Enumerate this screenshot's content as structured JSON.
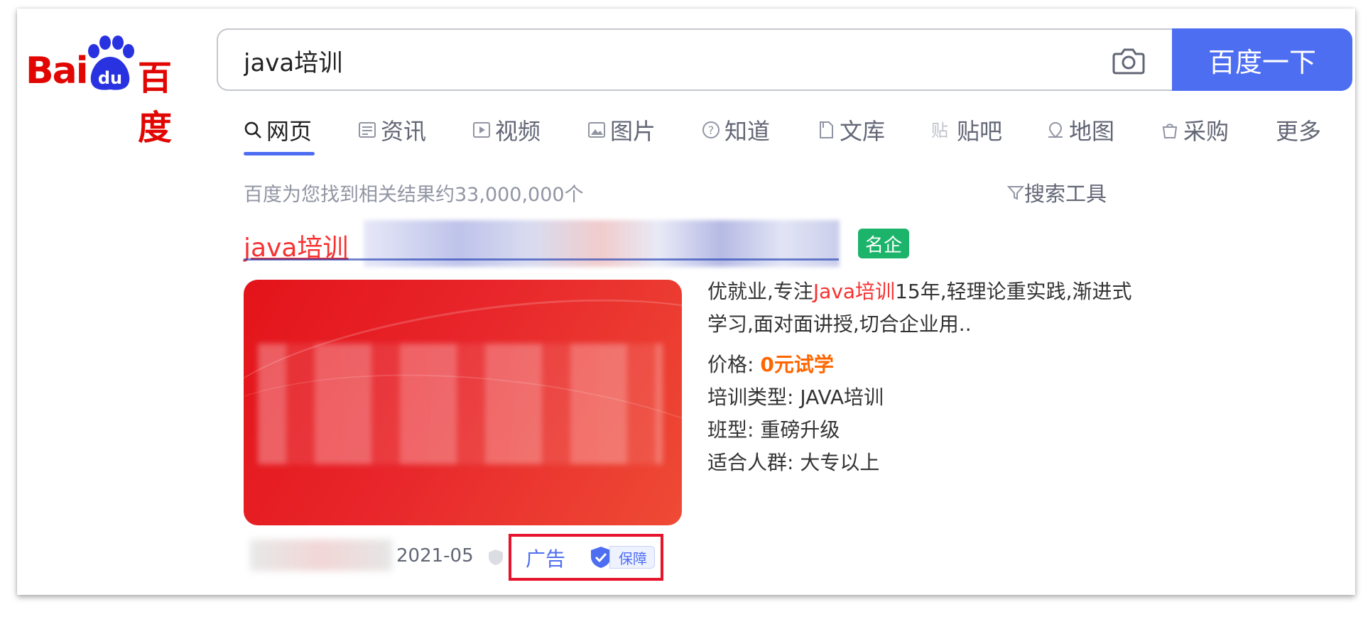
{
  "logo": {
    "bai": "Bai",
    "du": "du",
    "baidu_cn": "百度"
  },
  "search": {
    "value": "java培训",
    "button_label": "百度一下"
  },
  "tabs": [
    {
      "label": "网页",
      "icon": "search-icon",
      "active": true
    },
    {
      "label": "资讯",
      "icon": "news-icon"
    },
    {
      "label": "视频",
      "icon": "video-icon"
    },
    {
      "label": "图片",
      "icon": "image-icon"
    },
    {
      "label": "知道",
      "icon": "question-icon"
    },
    {
      "label": "文库",
      "icon": "document-icon"
    },
    {
      "label": "贴吧",
      "icon": "tieba-icon"
    },
    {
      "label": "地图",
      "icon": "map-icon"
    },
    {
      "label": "采购",
      "icon": "shop-icon"
    },
    {
      "label": "更多"
    }
  ],
  "result_count": "百度为您找到相关结果约33,000,000个",
  "search_tools": "搜索工具",
  "result": {
    "title_visible": "java培训",
    "badge": "名企",
    "desc_pre": "优就业,专注",
    "desc_hl": "Java培训",
    "desc_post": "15年,轻理论重实践,渐进式学习,面对面讲授,切合企业用..",
    "fields": [
      {
        "label": "价格:",
        "value": "0元试学"
      },
      {
        "label": "培训类型:",
        "value": "JAVA培训"
      },
      {
        "label": "班型:",
        "value": "重磅升级"
      },
      {
        "label": "适合人群:",
        "value": "大专以上"
      }
    ],
    "date": "2021-05",
    "ad_label": "广告",
    "guarantee_label": "保障"
  },
  "colors": {
    "brand_red": "#e10602",
    "accent_blue": "#4e6ef2",
    "title_red": "#f73131",
    "price_orange": "#ff6600",
    "badge_green": "#1cb46a",
    "highlight_frame": "#e5132b"
  }
}
